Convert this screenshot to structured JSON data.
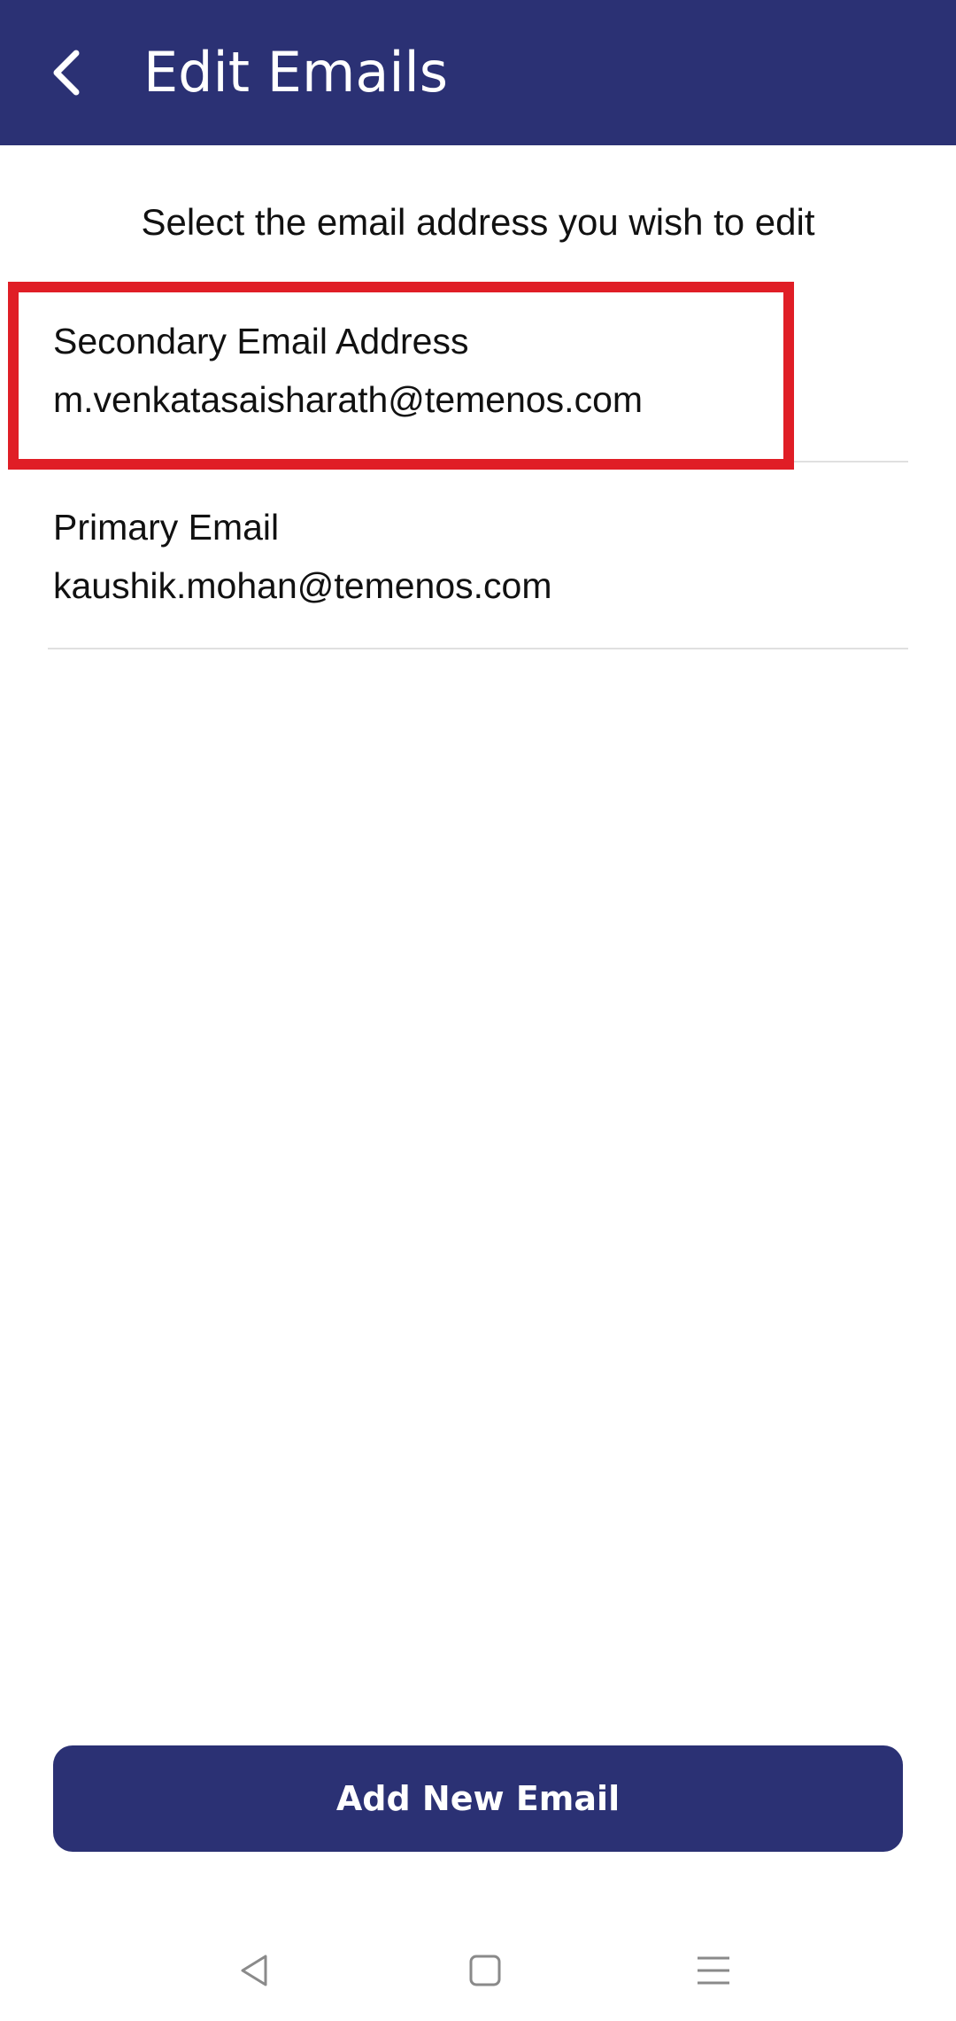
{
  "header": {
    "title": "Edit Emails",
    "back_icon": "chevron-left-icon",
    "background_color": "#2b3174"
  },
  "subtitle": "Select the email address you wish to edit",
  "emails": [
    {
      "label": "Secondary Email Address",
      "value": "m.venkatasaisharath@temenos.com",
      "highlighted": true
    },
    {
      "label": "Primary Email",
      "value": "kaushik.mohan@temenos.com",
      "highlighted": false
    }
  ],
  "highlight_color": "#e01e26",
  "add_button": {
    "label": "Add New Email",
    "color": "#2b3174"
  },
  "system_nav": {
    "back_icon": "nav-back-triangle-icon",
    "home_icon": "nav-home-square-icon",
    "menu_icon": "nav-menu-lines-icon"
  }
}
